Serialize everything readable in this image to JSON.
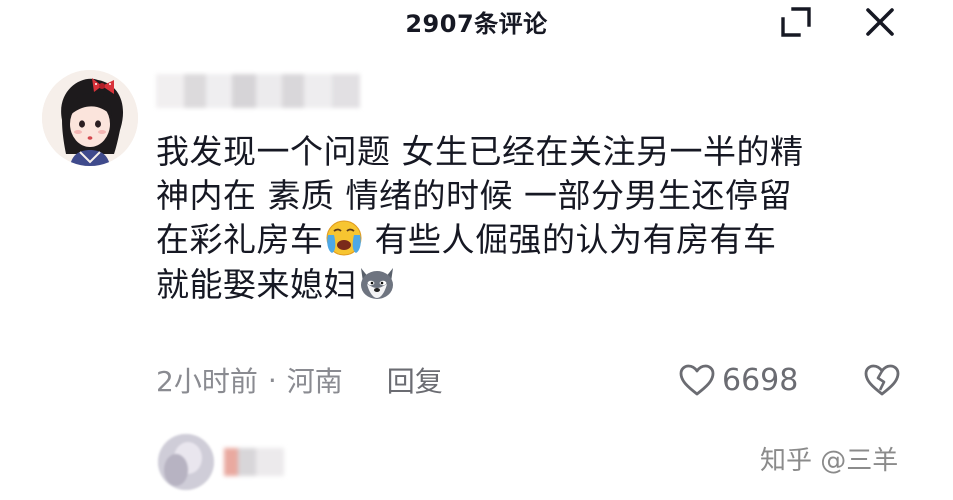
{
  "header": {
    "title": "2907条评论",
    "collapse_icon": "collapse-icon",
    "close_icon": "close-icon"
  },
  "comment": {
    "avatar_icon": "avatar-cartoon-girl",
    "text_lines": [
      "我发现一个问题 女生已经在关注另一半的精",
      "神内在 素质 情绪的时候 一部分男生还停留",
      "在彩礼房车",
      "有些人倔强的认为有房有车",
      "就能娶来媳妇"
    ],
    "emojis": [
      "crying-emoji",
      "husky-dog-emoji"
    ],
    "time": "2小时前",
    "separator": "·",
    "location": "河南",
    "reply_label": "回复",
    "like_icon": "heart-outline-icon",
    "like_count": "6698",
    "dislike_icon": "broken-heart-icon"
  },
  "next_comment": {
    "avatar_icon": "blurred-avatar"
  },
  "watermark": {
    "text": "知乎 @三羊"
  },
  "colors": {
    "text_primary": "#161823",
    "text_secondary": "#8a8b91",
    "background": "#ffffff"
  }
}
